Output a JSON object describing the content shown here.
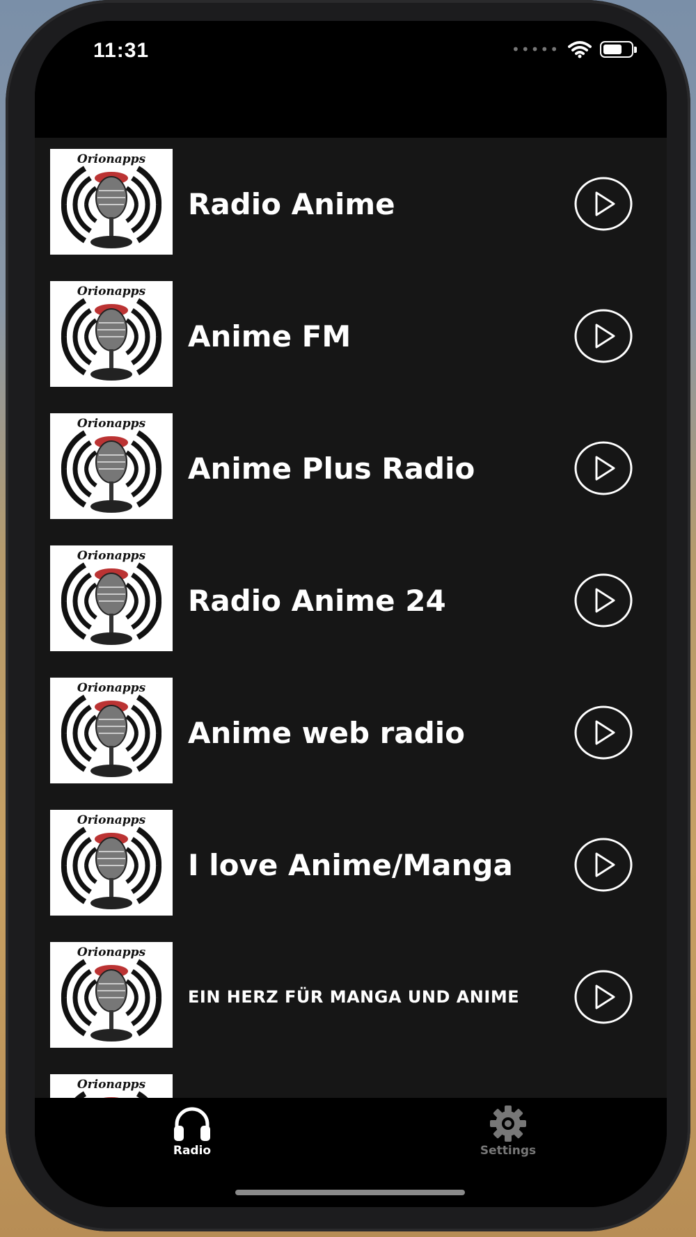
{
  "status_bar": {
    "time": "11:31",
    "signal_dots": "•••••"
  },
  "stations": [
    {
      "name": "Radio Anime",
      "logo_text": "Orionapps"
    },
    {
      "name": "Anime FM",
      "logo_text": "Orionapps"
    },
    {
      "name": "Anime Plus Radio",
      "logo_text": "Orionapps"
    },
    {
      "name": "Radio Anime 24",
      "logo_text": "Orionapps"
    },
    {
      "name": "Anime web radio",
      "logo_text": "Orionapps"
    },
    {
      "name": "I love Anime/Manga",
      "logo_text": "Orionapps"
    },
    {
      "name": "EIN HERZ FÜR MANGA UND ANIME",
      "logo_text": "Orionapps"
    },
    {
      "name": "",
      "logo_text": "Orionapps"
    }
  ],
  "tab_bar": {
    "radio_label": "Radio",
    "settings_label": "Settings",
    "active_color": "#ffffff",
    "inactive_color": "#777777"
  },
  "icons": {
    "play": "play-circle-icon",
    "radio_tab": "headphones-icon",
    "settings_tab": "gear-icon",
    "thumbnail": "microphone-logo-icon"
  }
}
